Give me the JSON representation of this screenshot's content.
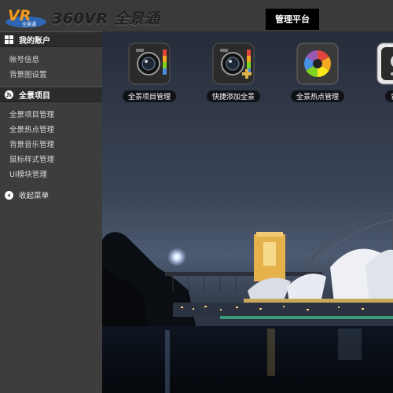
{
  "header": {
    "logo_badge_text": "VR",
    "logo_badge_subtext": "全景通",
    "brand_text": "360VR 全景通",
    "admin_tab": "管理平台"
  },
  "sidebar": {
    "sections": [
      {
        "title": "我的账户",
        "icon": "grid-icon",
        "items": [
          "帐号信息",
          "背景图设置"
        ]
      },
      {
        "title": "全景项目",
        "icon": "rss-icon",
        "items": [
          "全景项目管理",
          "全景热点管理",
          "背景音乐管理",
          "鼠标样式管理",
          "UI模块管理"
        ]
      }
    ],
    "collapse_label": "收起菜单"
  },
  "tiles": [
    {
      "label": "全景项目管理",
      "icon": "camera-app-icon"
    },
    {
      "label": "快捷添加全景",
      "icon": "camera-add-app-icon"
    },
    {
      "label": "全景热点管理",
      "icon": "aperture-app-icon"
    },
    {
      "label": "背景",
      "icon": "music-app-icon"
    }
  ],
  "colors": {
    "topbar": "#3a3a3a",
    "sidebar": "#3d3d3d",
    "section_header": "#2c2c2c",
    "admin_tab_bg": "#000000",
    "logo_orange": "#f39a1b",
    "logo_blue": "#2f66b3"
  }
}
